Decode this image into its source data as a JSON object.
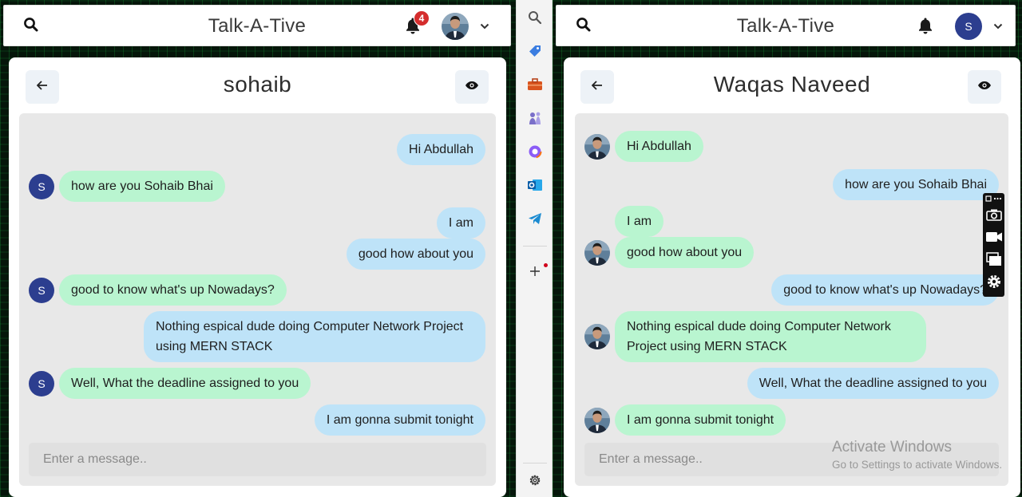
{
  "app_title": "Talk-A-Tive",
  "input_placeholder": "Enter a message..",
  "left": {
    "notification_count": "4",
    "chat_title": "sohaib",
    "sender_initial": "S",
    "messages": [
      {
        "text": "Hi Abdullah",
        "side": "sent"
      },
      {
        "text": "how are you Sohaib Bhai",
        "side": "recv"
      },
      {
        "text": "I am",
        "side": "sent"
      },
      {
        "text": "good how about you",
        "side": "sent"
      },
      {
        "text": "good to know what's up Nowadays?",
        "side": "recv"
      },
      {
        "text": "Nothing espical dude doing Computer Network Project using MERN STACK",
        "side": "sent"
      },
      {
        "text": "Well, What the deadline assigned to you",
        "side": "recv"
      },
      {
        "text": "I am gonna submit tonight",
        "side": "sent"
      }
    ]
  },
  "right": {
    "chat_title": "Waqas Naveed",
    "user_initial": "S",
    "messages": [
      {
        "text": "Hi Abdullah",
        "side": "recv"
      },
      {
        "text": "how are you Sohaib Bhai",
        "side": "sent"
      },
      {
        "text": "I am",
        "side": "recv"
      },
      {
        "text": "good how about you",
        "side": "recv"
      },
      {
        "text": "good to know what's up Nowadays?",
        "side": "sent"
      },
      {
        "text": "Nothing espical dude doing Computer Network Project using MERN STACK",
        "side": "recv"
      },
      {
        "text": "Well, What the deadline assigned to you",
        "side": "sent"
      },
      {
        "text": "I am gonna submit tonight",
        "side": "recv"
      }
    ]
  },
  "watermark": {
    "title": "Activate Windows",
    "subtitle": "Go to Settings to activate Windows."
  },
  "colors": {
    "sent_bubble": "#bee3f8",
    "recv_bubble": "#b9f5d0",
    "badge": "#d42d2d",
    "initial_avatar": "#2c3e8f"
  }
}
